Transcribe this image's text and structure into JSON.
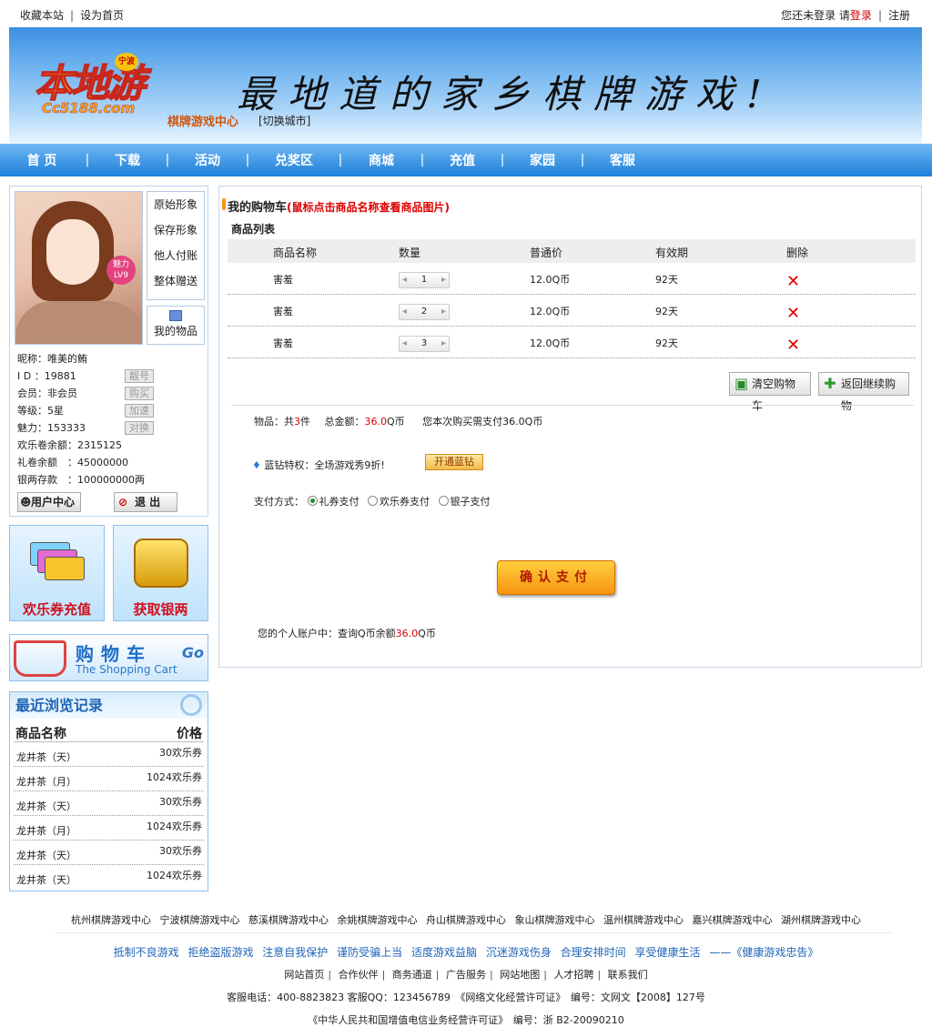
{
  "topbar": {
    "bookmark": "收藏本站",
    "homepage": "设为首页",
    "not_logged": "您还未登录 请",
    "login": "登录",
    "register": "注册"
  },
  "banner": {
    "logo_main": "本地游",
    "logo_sub": "Cc5188.com",
    "logo_badge": "宁波",
    "slogan": "最地道的家乡棋牌游戏!",
    "center_name": "棋牌游戏中心",
    "switch_city": "[切换城市]"
  },
  "nav": {
    "items": [
      "首 页",
      "下载",
      "活动",
      "兑奖区",
      "商城",
      "充值",
      "家园",
      "客服"
    ]
  },
  "profile": {
    "buttons": [
      "原始形象",
      "保存形象",
      "他人付账",
      "整体赠送"
    ],
    "my_items": "我的物品",
    "level_badge": "魅力 LV9",
    "nickname": "昵称：唯美的鲔",
    "id": "I D ：19881",
    "member": "会员：非会员",
    "level": "等级：5星",
    "charm": "魅力：153333",
    "happy_coupon": "欢乐卷余额：2315125",
    "gift_coupon": "礼卷余额　：45000000",
    "silver": "银两存款　：100000000两",
    "btn_id": "靓号",
    "btn_buy": "购买",
    "btn_speed": "加速",
    "btn_exchange": "对换",
    "user_center": "用户中心",
    "logout": "退 出"
  },
  "promos": {
    "recharge": "欢乐券充值",
    "silver": "获取银两"
  },
  "cart_banner": {
    "cn": "购物车",
    "en": "The Shopping Cart",
    "go": "Go"
  },
  "recent": {
    "title": "最近浏览记录",
    "col_name": "商品名称",
    "col_price": "价格",
    "rows": [
      {
        "name": "龙井茶（天）",
        "price": "30欢乐券"
      },
      {
        "name": "龙井茶（月）",
        "price": "1024欢乐券"
      },
      {
        "name": "龙井茶（天）",
        "price": "30欢乐券"
      },
      {
        "name": "龙井茶（月）",
        "price": "1024欢乐券"
      },
      {
        "name": "龙井茶（天）",
        "price": "30欢乐券"
      },
      {
        "name": "龙井茶（天）",
        "price": "1024欢乐券"
      }
    ]
  },
  "cart": {
    "title": "我的购物车",
    "hint": "(鼠标点击商品名称查看商品图片)",
    "list_title": "商品列表",
    "headers": [
      "商品名称",
      "数量",
      "普通价",
      "有效期",
      "删除"
    ],
    "rows": [
      {
        "name": "害羞",
        "qty": "1",
        "price": "12.0Q币",
        "valid": "92天"
      },
      {
        "name": "害羞",
        "qty": "2",
        "price": "12.0Q币",
        "valid": "92天"
      },
      {
        "name": "害羞",
        "qty": "3",
        "price": "12.0Q币",
        "valid": "92天"
      }
    ],
    "clear_btn": "清空购物车",
    "continue_btn": "返回继续购物",
    "summary_items_pre": "物品：共",
    "summary_items_num": "3",
    "summary_items_post": "件",
    "summary_total_pre": "总金额：",
    "summary_total_num": "36.0",
    "summary_total_post": "Q币",
    "summary_pay": "您本次购买需支付36.0Q币",
    "vip_text": "蓝钻特权：全场游戏秀9折!",
    "vip_btn": "开通蓝钻",
    "pay_label": "支付方式：",
    "pay_options": [
      "礼券支付",
      "欢乐券支付",
      "银子支付"
    ],
    "confirm": "确认支付",
    "account_pre": "您的个人账户中：查询Q币余额",
    "account_num": "36.0",
    "account_post": "Q币"
  },
  "footer": {
    "cities": [
      "杭州棋牌游戏中心",
      "宁波棋牌游戏中心",
      "慈溪棋牌游戏中心",
      "余姚棋牌游戏中心",
      "舟山棋牌游戏中心",
      "象山棋牌游戏中心",
      "温州棋牌游戏中心",
      "嘉兴棋牌游戏中心",
      "湖州棋牌游戏中心"
    ],
    "warnings": [
      "抵制不良游戏",
      "拒绝盗版游戏",
      "注意自我保护",
      "谨防受骗上当",
      "适度游戏益脑",
      "沉迷游戏伤身",
      "合理安排时间",
      "享受健康生活",
      "——《健康游戏忠告》"
    ],
    "links": [
      "网站首页",
      "合作伙伴",
      "商务通道",
      "广告服务",
      "网站地图",
      "人才招聘",
      "联系我们"
    ],
    "line1": "客服电话：400-8823823 客服QQ：123456789　《网络文化经营许可证》　编号：文网文【2008】127号",
    "line2": "《中华人民共和国增值电信业务经营许可证》　编号：浙 B2-20090210"
  },
  "colors": {
    "nav": "#1e7fd8",
    "accent_red": "#cc0000",
    "confirm_orange": "#f79510"
  }
}
